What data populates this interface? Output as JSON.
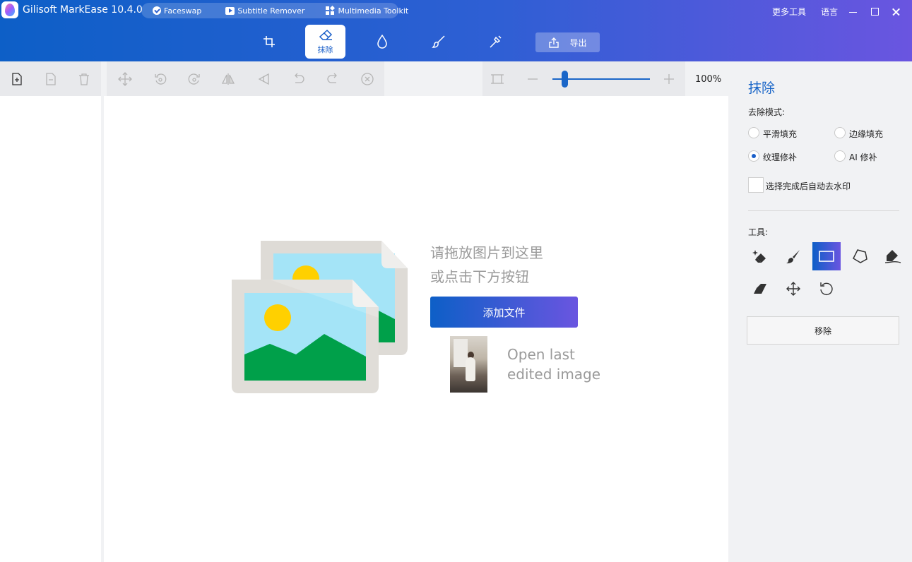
{
  "app": {
    "title": "Gilisoft MarkEase 10.4.0"
  },
  "quick_links": [
    {
      "label": "Faceswap",
      "icon": "check-circle-icon"
    },
    {
      "label": "Subtitle Remover",
      "icon": "play-icon"
    },
    {
      "label": "Multimedia Toolkit",
      "icon": "grid-icon"
    }
  ],
  "top_right": {
    "more_tools": "更多工具",
    "language": "语言"
  },
  "mode_tabs": [
    {
      "name": "crop",
      "label": "",
      "icon": "crop-icon"
    },
    {
      "name": "erase",
      "label": "抹除",
      "icon": "eraser-icon",
      "active": true
    },
    {
      "name": "watermark",
      "label": "",
      "icon": "drop-icon"
    },
    {
      "name": "brush",
      "label": "",
      "icon": "brush-icon"
    },
    {
      "name": "magic",
      "label": "",
      "icon": "magic-wand-icon"
    }
  ],
  "export": {
    "label": "导出",
    "icon": "export-icon"
  },
  "zoom": {
    "text": "100%",
    "level": 0.1
  },
  "canvas": {
    "drop_line1": "请拖放图片到这里",
    "drop_line2": "或点击下方按钮",
    "add_file": "添加文件",
    "last_line1": "Open last",
    "last_line2": "edited image"
  },
  "panel": {
    "title": "抹除",
    "mode_label": "去除模式:",
    "modes": [
      {
        "label": "平滑填充",
        "checked": false
      },
      {
        "label": "边缘填充",
        "checked": false
      },
      {
        "label": "纹理修补",
        "checked": true
      },
      {
        "label": "AI 修补",
        "checked": false
      }
    ],
    "auto_remove": "选择完成后自动去水印",
    "tools_label": "工具:",
    "remove": "移除"
  },
  "colors": {
    "accent": "#1a66c8",
    "gradient_start": "#0d5fc7",
    "gradient_end": "#6a55e0"
  }
}
